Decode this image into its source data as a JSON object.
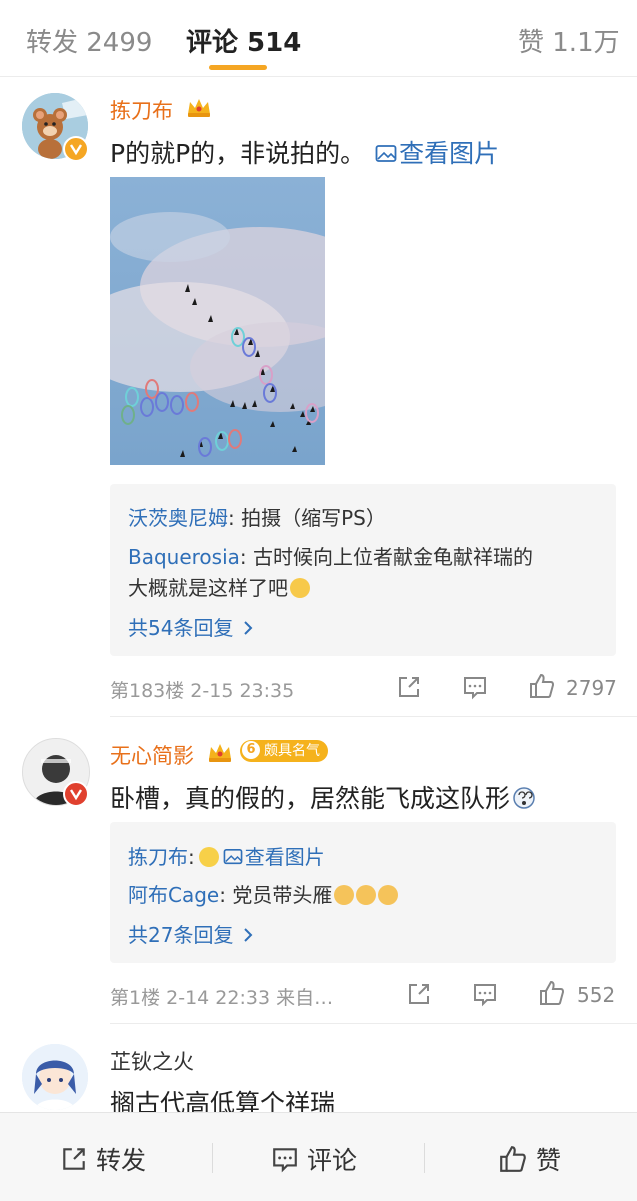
{
  "tabs": {
    "repost": "转发 2499",
    "comments": "评论 514",
    "likes": "赞 1.1万"
  },
  "comments": [
    {
      "username": "拣刀布",
      "text": "P的就P的，非说拍的。",
      "image_link": "查看图片",
      "replies": [
        {
          "name": "沃茨奥尼姆",
          "text": ": 拍摄（缩写PS）"
        },
        {
          "name": "Baquerosia",
          "text": ": 古时候向上位者献金龟献祥瑞的",
          "text2": "大概就是这样了吧"
        }
      ],
      "more_replies": "共54条回复",
      "meta": "第183楼  2-15 23:35",
      "like_count": "2797"
    },
    {
      "username": "无心简影",
      "level_badge": "颇具名气",
      "level_number": "6",
      "text": "卧槽，真的假的，居然能飞成这队形",
      "replies": [
        {
          "name": "拣刀布",
          "text": ":",
          "link": "查看图片"
        },
        {
          "name": "阿布Cage",
          "text": ": 党员带头雁"
        }
      ],
      "more_replies": "共27条回复",
      "meta": "第1楼  2-14 22:33  来自…",
      "like_count": "552"
    },
    {
      "username": "芷钬之火",
      "text": "搁古代高低算个祥瑞"
    }
  ],
  "bottom_bar": {
    "repost": "转发",
    "comment": "评论",
    "like": "赞"
  },
  "colors": {
    "accent": "#f5a623",
    "username": "#e8701a",
    "link": "#2f6fb8"
  }
}
